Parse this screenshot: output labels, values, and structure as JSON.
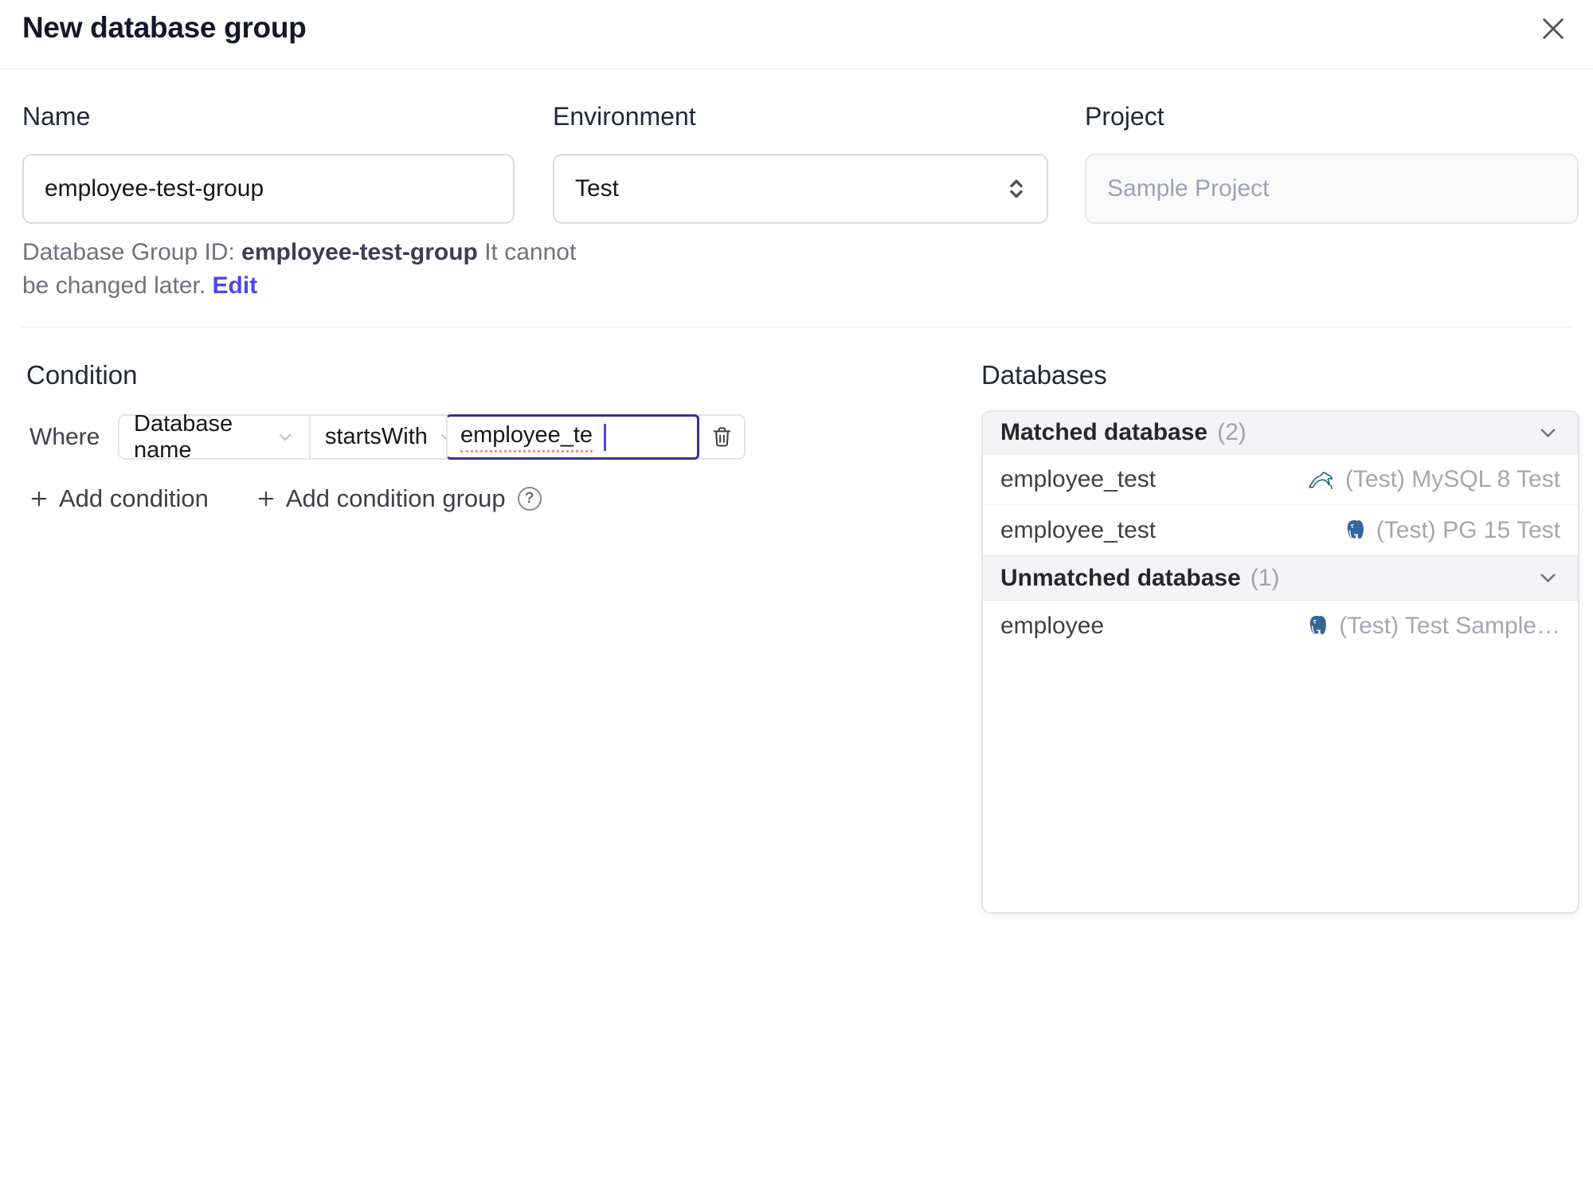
{
  "dialog": {
    "title": "New database group"
  },
  "form": {
    "name": {
      "label": "Name",
      "value": "employee-test-group"
    },
    "environment": {
      "label": "Environment",
      "value": "Test"
    },
    "project": {
      "label": "Project",
      "value": "Sample Project"
    },
    "id_note": {
      "prefix": "Database Group ID: ",
      "id": "employee-test-group",
      "suffix": " It cannot be changed later. ",
      "edit_label": "Edit"
    }
  },
  "condition": {
    "heading": "Condition",
    "where_label": "Where",
    "field": "Database name",
    "operator": "startsWith",
    "value": "employee_te",
    "add_condition": "Add condition",
    "add_condition_group": "Add condition group"
  },
  "databases": {
    "heading": "Databases",
    "groups": [
      {
        "title": "Matched database",
        "count": "(2)",
        "rows": [
          {
            "name": "employee_test",
            "engine": "mysql",
            "instance": "(Test) MySQL 8 Test"
          },
          {
            "name": "employee_test",
            "engine": "postgres",
            "instance": "(Test) PG 15 Test"
          }
        ]
      },
      {
        "title": "Unmatched database",
        "count": "(1)",
        "rows": [
          {
            "name": "employee",
            "engine": "postgres",
            "instance": "(Test) Test Sample…"
          }
        ]
      }
    ]
  },
  "icons": {
    "help": "?"
  },
  "colors": {
    "accent_indigo": "#4f46e5",
    "focus_border": "#3b338f",
    "mysql_teal": "#155e75",
    "postgres_blue": "#36679b",
    "muted_gray": "#a6a6ae"
  }
}
